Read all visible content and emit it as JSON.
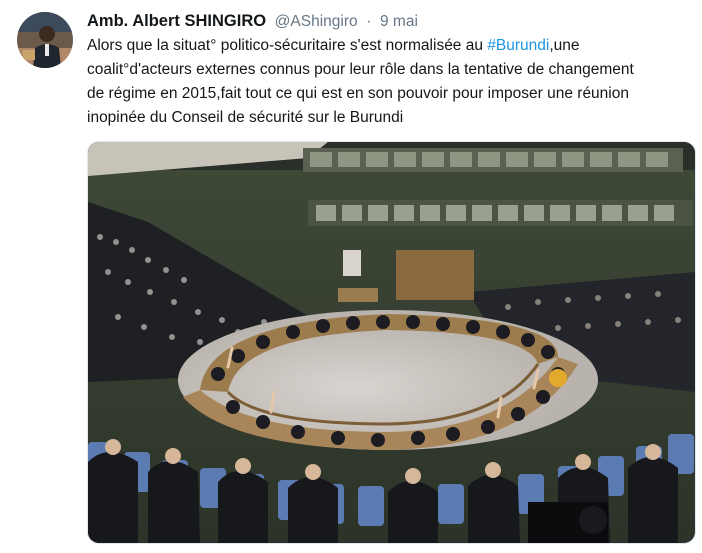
{
  "tweet": {
    "author_name": "Amb. Albert SHINGIRO",
    "handle": "@AShingiro",
    "separator": "·",
    "time": "9 mai",
    "line1_before_hashtag": "Alors que la situat° politico-sécuritaire s'est normalisée au ",
    "hashtag": "#Burundi",
    "line1_after_hashtag": ",une",
    "line2": "coalit°d'acteurs externes connus pour leur rôle dans la tentative de changement",
    "line3": "de régime en 2015,fait tout ce qui est en son pouvoir pour imposer une réunion",
    "line4": "inopinée du Conseil de sécurité sur le Burundi"
  },
  "colors": {
    "link": "#1b95e0",
    "secondary_text": "#657786",
    "primary_text": "#14171a"
  },
  "icons": {
    "avatar": "profile-photo",
    "media": "un-security-council-chamber-photo"
  }
}
